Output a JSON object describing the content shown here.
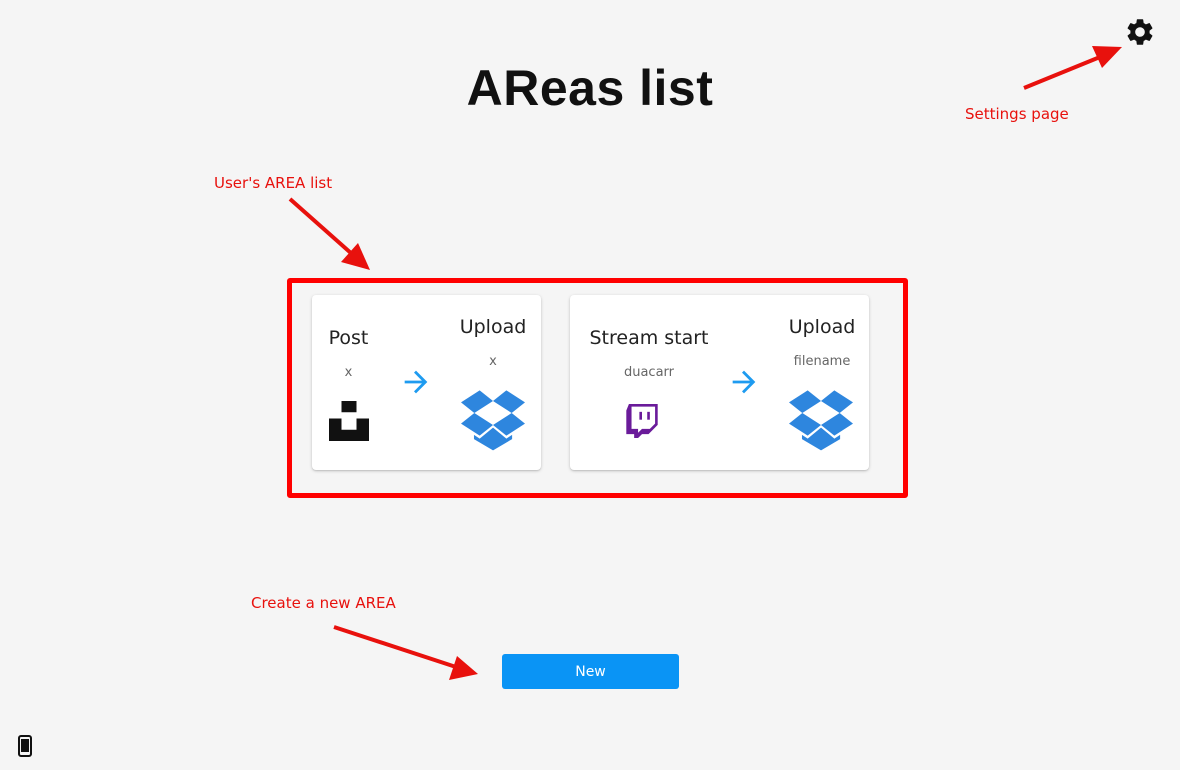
{
  "page": {
    "title": "AReas list"
  },
  "annotations": {
    "settings": "Settings page",
    "list": "User's AREA list",
    "create": "Create a new AREA"
  },
  "areas": [
    {
      "action": {
        "name": "Post",
        "param": "x",
        "service_icon": "unsplash-icon"
      },
      "reaction": {
        "name": "Upload",
        "param": "x",
        "service_icon": "dropbox-icon"
      }
    },
    {
      "action": {
        "name": "Stream start",
        "param": "duacarr",
        "service_icon": "twitch-icon"
      },
      "reaction": {
        "name": "Upload",
        "param": "filename",
        "service_icon": "dropbox-icon"
      }
    }
  ],
  "buttons": {
    "new_label": "New"
  },
  "icons": {
    "settings": "gear-icon",
    "flow": "arrow-right-icon",
    "device": "phone-icon"
  },
  "colors": {
    "background": "#f5f5f5",
    "annotation": "#e8110d",
    "highlight_border": "#ff0000",
    "accent_blue": "#0a94f5",
    "flow_arrow": "#1e9bf0",
    "dropbox": "#2e86de",
    "twitch": "#6a1b9a"
  }
}
